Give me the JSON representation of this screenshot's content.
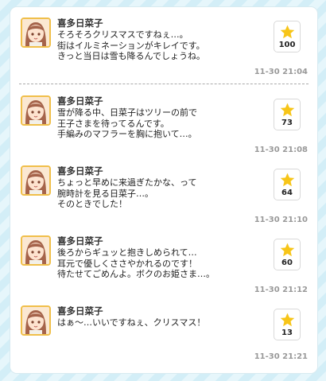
{
  "posts": [
    {
      "author": "喜多日菜子",
      "lines": [
        "そろそろクリスマスですねぇ…。",
        "街はイルミネーションがキレイです。",
        "きっと当日は雪も降るんでしょうね。"
      ],
      "likes": "100",
      "time": "11-30 21:04"
    },
    {
      "author": "喜多日菜子",
      "lines": [
        "雪が降る中、日菜子はツリーの前で",
        "王子さまを待ってるんです。",
        "手編みのマフラーを胸に抱いて…。"
      ],
      "likes": "73",
      "time": "11-30 21:08"
    },
    {
      "author": "喜多日菜子",
      "lines": [
        "ちょっと早めに来過ぎたかな、って",
        "腕時計を見る日菜子…。",
        "そのときでした！"
      ],
      "likes": "64",
      "time": "11-30 21:10"
    },
    {
      "author": "喜多日菜子",
      "lines": [
        "後ろからギュッと抱きしめられて…",
        "耳元で優しくささやかれるのです！",
        "待たせてごめんよ。ボクのお姫さま…。"
      ],
      "likes": "60",
      "time": "11-30 21:12"
    },
    {
      "author": "喜多日菜子",
      "lines": [
        "はぁ〜…いいですねぇ、クリスマス！"
      ],
      "likes": "13",
      "time": "11-30 21:21"
    }
  ],
  "icons": {
    "like": "star-icon",
    "avatar": "hinako-avatar"
  },
  "colors": {
    "star": "#f7c518",
    "avatar_border": "#f0bf4a",
    "timestamp": "#999999",
    "background_stripe": "#d3eef7"
  }
}
